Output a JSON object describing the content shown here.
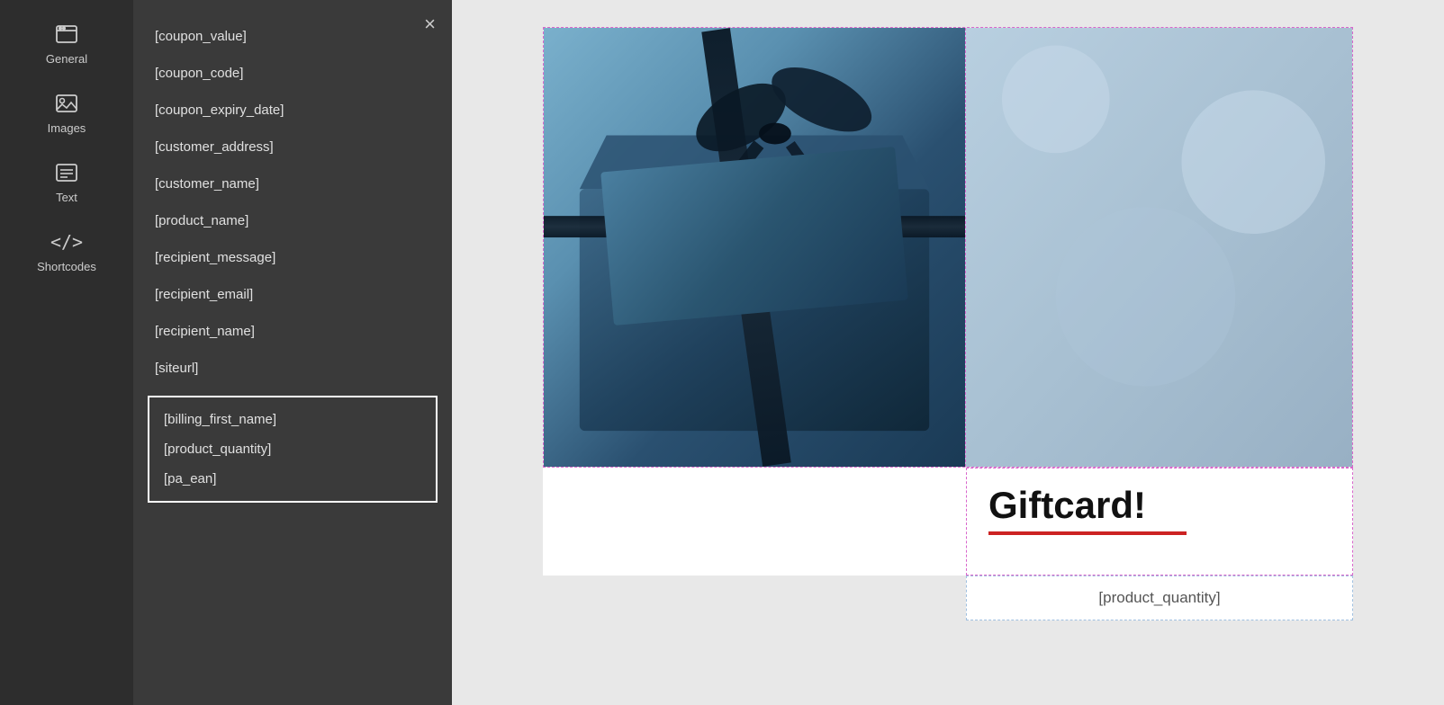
{
  "sidebar": {
    "items": [
      {
        "id": "general",
        "label": "General",
        "icon": "browser-icon"
      },
      {
        "id": "images",
        "label": "Images",
        "icon": "image-icon"
      },
      {
        "id": "text",
        "label": "Text",
        "icon": "text-icon"
      },
      {
        "id": "shortcodes",
        "label": "Shortcodes",
        "icon": "code-icon"
      }
    ]
  },
  "panel": {
    "close_button": "×",
    "shortcodes": [
      {
        "id": "coupon_value",
        "label": "[coupon_value]"
      },
      {
        "id": "coupon_code",
        "label": "[coupon_code]"
      },
      {
        "id": "coupon_expiry_date",
        "label": "[coupon_expiry_date]"
      },
      {
        "id": "customer_address",
        "label": "[customer_address]"
      },
      {
        "id": "customer_name",
        "label": "[customer_name]"
      },
      {
        "id": "product_name",
        "label": "[product_name]"
      },
      {
        "id": "recipient_message",
        "label": "[recipient_message]"
      },
      {
        "id": "recipient_email",
        "label": "[recipient_email]"
      },
      {
        "id": "recipient_name",
        "label": "[recipient_name]"
      },
      {
        "id": "siteurl",
        "label": "[siteurl]"
      }
    ],
    "shortcode_group": [
      {
        "id": "billing_first_name",
        "label": "[billing_first_name]"
      },
      {
        "id": "product_quantity",
        "label": "[product_quantity]"
      },
      {
        "id": "pa_ean",
        "label": "[pa_ean]"
      }
    ]
  },
  "canvas": {
    "giftcard_title": "Giftcard!",
    "product_quantity_placeholder": "[product_quantity]"
  }
}
